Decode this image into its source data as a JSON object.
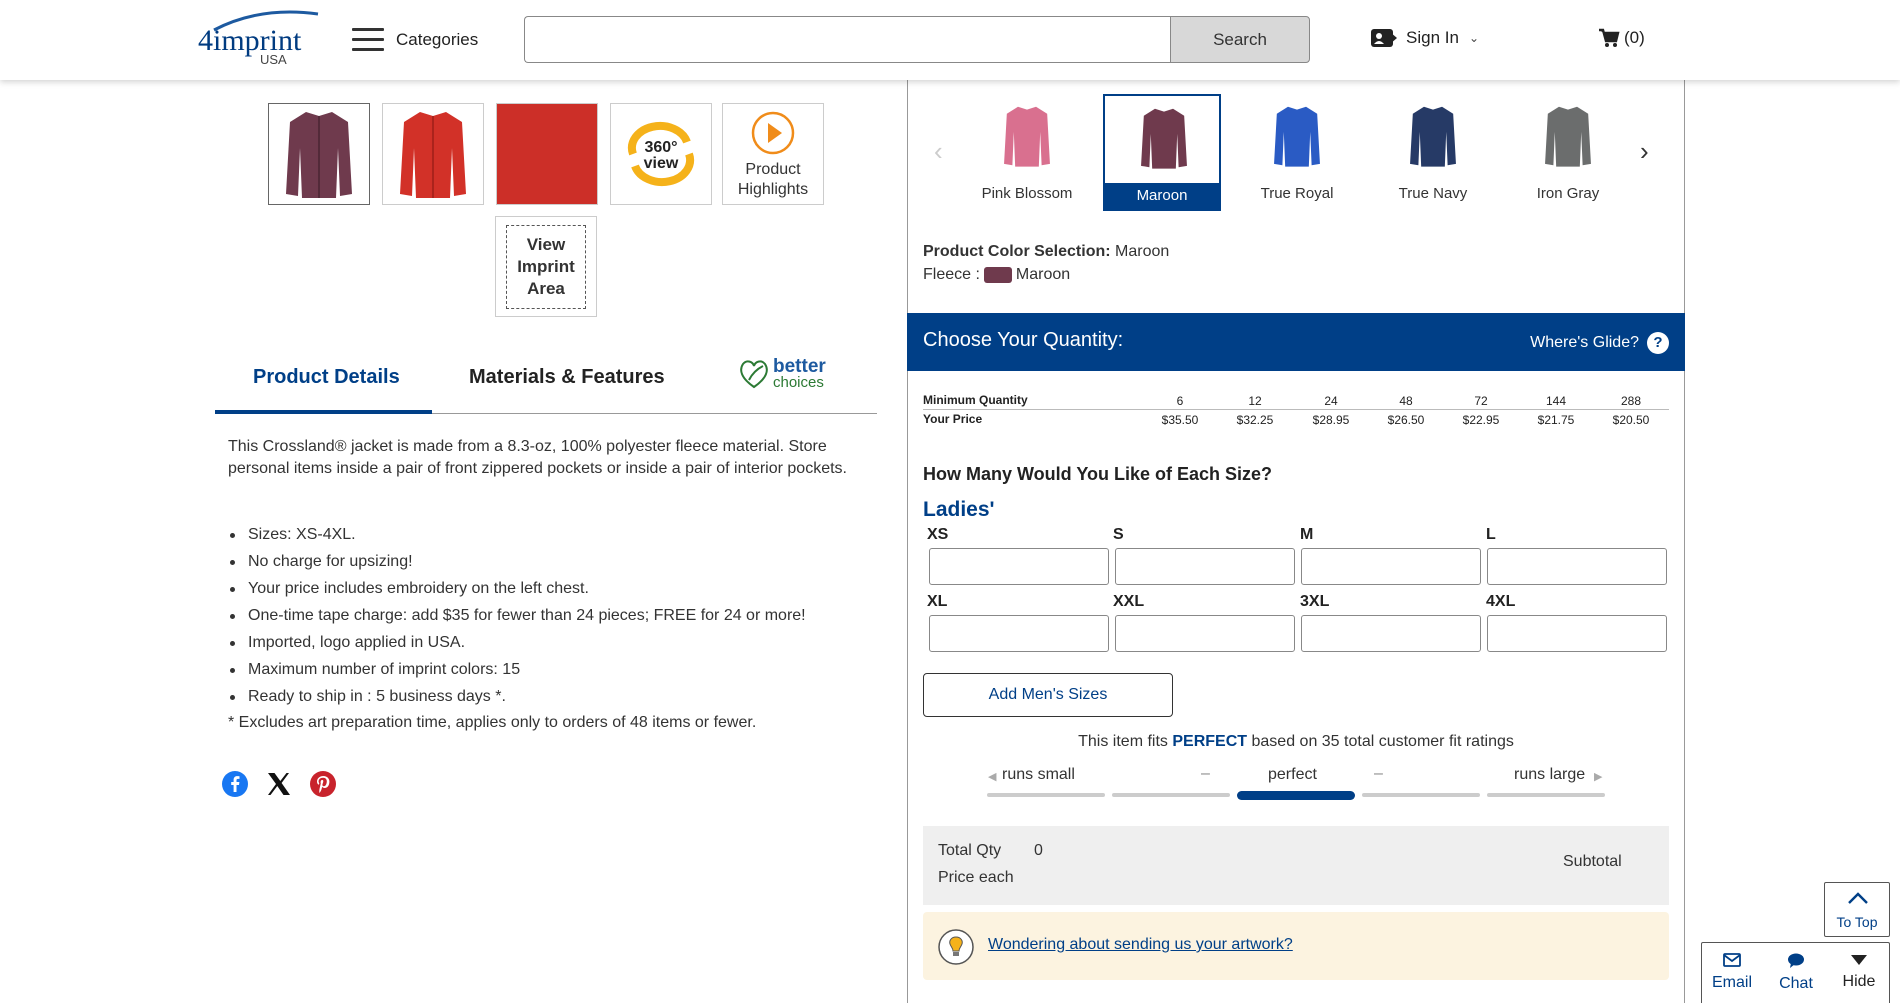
{
  "header": {
    "logo_text": "4imprint",
    "logo_sub": "USA",
    "categories_label": "Categories",
    "search_placeholder": "",
    "search_button": "Search",
    "signin_label": "Sign In",
    "cart_label": "(0)"
  },
  "gallery": {
    "highlights_label": "Product Highlights",
    "view360_line1": "360°",
    "view360_line2": "view",
    "imprint_label": "View\nImprint\nArea"
  },
  "tabs": {
    "details": "Product Details",
    "materials": "Materials & Features",
    "better_1": "better",
    "better_2": "choices"
  },
  "description": "This Crossland® jacket is made from a 8.3-oz, 100% polyester fleece material. Store personal items inside a pair of front zippered pockets or inside a pair of interior pockets.",
  "bullets": [
    "Sizes: XS-4XL.",
    "No charge for upsizing!",
    "Your price includes embroidery on the left chest.",
    "One-time tape charge: add $35 for fewer than 24 pieces; FREE for 24 or more!",
    "Imported, logo applied in USA.",
    "Maximum number of imprint colors: 15",
    "Ready to ship in : 5 business days *."
  ],
  "footnote": "* Excludes art preparation time, applies only to orders of 48 items or fewer.",
  "colors": {
    "swatches": [
      {
        "name": "Pink Blossom",
        "color": "#d9708f"
      },
      {
        "name": "Maroon",
        "color": "#6f3a4d"
      },
      {
        "name": "True Royal",
        "color": "#2a5bc4"
      },
      {
        "name": "True Navy",
        "color": "#263a66"
      },
      {
        "name": "Iron Gray",
        "color": "#6b6d6d"
      }
    ],
    "selected": "Maroon",
    "selection_label": "Product Color Selection:",
    "selection_value": "Maroon",
    "fleece_label": "Fleece :",
    "fleece_value": "Maroon"
  },
  "quantity": {
    "title": "Choose Your Quantity:",
    "glide_label": "Where's Glide?",
    "glide_icon": "?",
    "min_label": "Minimum Quantity",
    "price_label": "Your Price",
    "breaks": [
      "6",
      "12",
      "24",
      "48",
      "72",
      "144",
      "288"
    ],
    "prices": [
      "$35.50",
      "$32.25",
      "$28.95",
      "$26.50",
      "$22.95",
      "$21.75",
      "$20.50"
    ]
  },
  "sizes": {
    "question": "How Many Would You Like of Each Size?",
    "group": "Ladies'",
    "list": [
      "XS",
      "S",
      "M",
      "L",
      "XL",
      "XXL",
      "3XL",
      "4XL"
    ],
    "add_mens": "Add Men's Sizes"
  },
  "fit": {
    "prefix": "This item fits",
    "rating": "PERFECT",
    "suffix": "based on 35 total customer fit ratings",
    "runs_small": "runs small",
    "perfect": "perfect",
    "runs_large": "runs large",
    "dash": "–",
    "selected_segment": 3
  },
  "totals": {
    "total_qty_label": "Total Qty",
    "total_qty_value": "0",
    "price_each_label": "Price each",
    "subtotal_label": "Subtotal"
  },
  "artwork_link": "Wondering about sending us your artwork?",
  "widgets": {
    "to_top": "To Top",
    "email": "Email",
    "chat": "Chat",
    "hide": "Hide"
  }
}
